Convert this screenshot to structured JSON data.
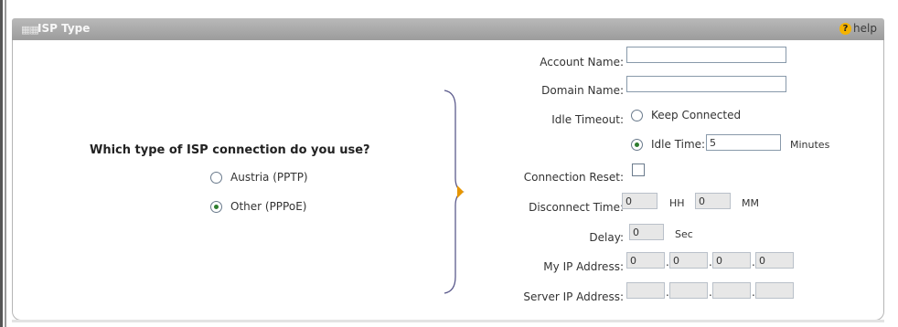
{
  "header": {
    "title": "ISP Type",
    "help_label": "help"
  },
  "isp": {
    "question": "Which type of ISP connection do you use?",
    "options": [
      {
        "label": "Austria (PPTP)",
        "selected": false
      },
      {
        "label": "Other (PPPoE)",
        "selected": true
      }
    ]
  },
  "form": {
    "account_name": {
      "label": "Account Name:",
      "value": ""
    },
    "domain_name": {
      "label": "Domain Name:",
      "value": ""
    },
    "idle_timeout": {
      "label": "Idle Timeout:",
      "keep_connected": "Keep Connected",
      "idle_time_label": "Idle Time:",
      "idle_time_value": "5",
      "minutes": "Minutes",
      "selected": "idle_time"
    },
    "connection_reset": {
      "label": "Connection Reset:",
      "checked": false
    },
    "disconnect_time": {
      "label": "Disconnect Time:",
      "hh_value": "0",
      "hh_unit": "HH",
      "mm_value": "0",
      "mm_unit": "MM"
    },
    "delay": {
      "label": "Delay:",
      "value": "0",
      "unit": "Sec"
    },
    "my_ip": {
      "label": "My IP Address:",
      "octets": [
        "0",
        "0",
        "0",
        "0"
      ],
      "separator": "."
    },
    "server_ip": {
      "label": "Server IP Address:",
      "octets": [
        "",
        "",
        "",
        ""
      ],
      "separator": "."
    }
  },
  "colors": {
    "header_bg": "#a9a9a9",
    "radio_selected": "#2f7d2f",
    "help_icon": "#f4b300",
    "brace": "#5b5a8c",
    "arrow": "#e69500"
  }
}
